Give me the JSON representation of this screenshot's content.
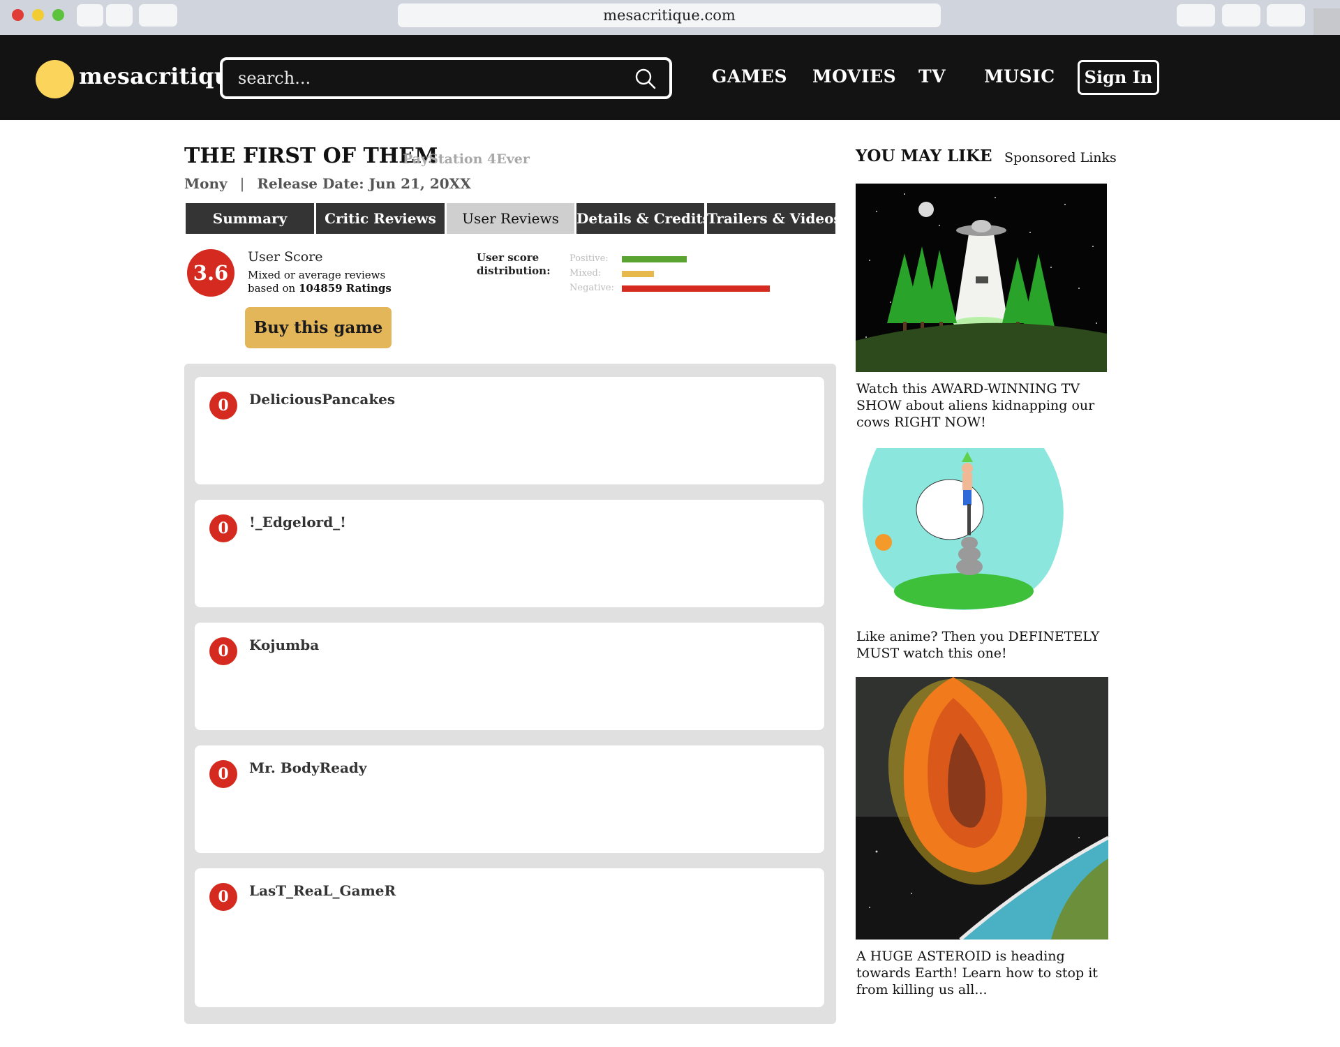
{
  "browser": {
    "url": "mesacritique.com"
  },
  "header": {
    "logo_text": "mesacritique",
    "search_placeholder": "search...",
    "nav": [
      "GAMES",
      "MOVIES",
      "TV",
      "MUSIC"
    ],
    "signin_label": "Sign In"
  },
  "game": {
    "title": "THE FIRST OF THEM",
    "platform": "PayStation 4Ever",
    "publisher": "Mony",
    "separator": "|",
    "release": "Release Date: Jun 21, 20XX"
  },
  "tabs": [
    "Summary",
    "Critic Reviews",
    "User Reviews",
    "Details & Credits",
    "Trailers & Videos"
  ],
  "active_tab": "User Reviews",
  "score": {
    "value": "3.6",
    "label": "User Score",
    "desc_line1": "Mixed or average reviews",
    "desc_prefix": "based on ",
    "ratings": "104859 Ratings",
    "buy_label": "Buy this game",
    "distribution_label": "User score distribution:",
    "distribution": [
      {
        "label": "Positive:",
        "fraction": 0.41,
        "color": "#5aa532"
      },
      {
        "label": "Mixed:",
        "fraction": 0.2,
        "color": "#e6b94a"
      },
      {
        "label": "Negative:",
        "fraction": 0.93,
        "color": "#d42a1f"
      }
    ]
  },
  "reviews": [
    {
      "score": "0",
      "user": "DeliciousPancakes"
    },
    {
      "score": "0",
      "user": "!_Edgelord_!"
    },
    {
      "score": "0",
      "user": "Kojumba"
    },
    {
      "score": "0",
      "user": "Mr. BodyReady"
    },
    {
      "score": "0",
      "user": "LasT_ReaL_GameR"
    }
  ],
  "sidebar": {
    "title": "YOU MAY LIKE",
    "sponsored": "Sponsored Links",
    "ads": [
      {
        "caption": "Watch this AWARD-WINNING TV SHOW about aliens kidnapping our cows RIGHT NOW!"
      },
      {
        "caption": "Like anime? Then you DEFINETELY MUST watch this one!"
      },
      {
        "caption": "A HUGE ASTEROID is heading towards Earth! Learn how to stop it from killing us all..."
      }
    ]
  },
  "colors": {
    "accent_yellow": "#fbd45b",
    "score_red": "#d42a1f",
    "buy_gold": "#e4b65a",
    "header_bg": "#131313"
  }
}
